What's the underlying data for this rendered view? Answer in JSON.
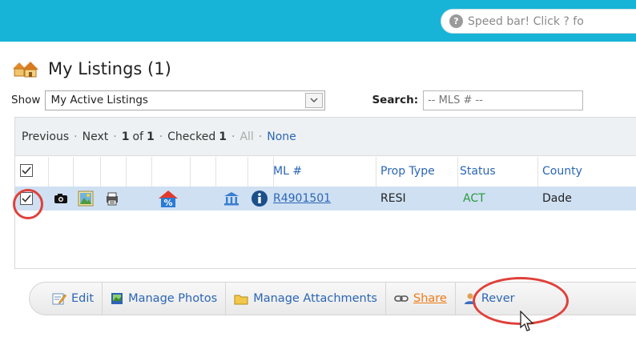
{
  "speedbar": {
    "text": "Speed bar! Click ? fo",
    "help_glyph": "?"
  },
  "page": {
    "title": "My Listings (1)"
  },
  "filters": {
    "show_label": "Show",
    "show_value": "My Active Listings",
    "search_label": "Search:",
    "search_placeholder": "-- MLS # --"
  },
  "pager": {
    "previous": "Previous",
    "next": "Next",
    "page_current": "1",
    "page_of": "of",
    "page_total": "1",
    "checked_label": "Checked",
    "checked_count": "1",
    "all": "All",
    "none": "None"
  },
  "table": {
    "headers": {
      "mls": "ML #",
      "prop_type": "Prop Type",
      "status": "Status",
      "county": "County"
    },
    "rows": [
      {
        "mls": "R4901501",
        "prop_type": "RESI",
        "status": "ACT",
        "county": "Dade",
        "checked": true
      }
    ]
  },
  "toolbar": {
    "edit": "Edit",
    "manage_photos": "Manage Photos",
    "manage_attachments": "Manage Attachments",
    "share": "Share",
    "reverse": "Rever"
  },
  "colors": {
    "topbar": "#17b4d8",
    "link": "#2b66b5",
    "share": "#f07a16",
    "status_act": "#2a9a3c",
    "highlight": "#e0403a",
    "row_selected": "#cfe0f3"
  }
}
